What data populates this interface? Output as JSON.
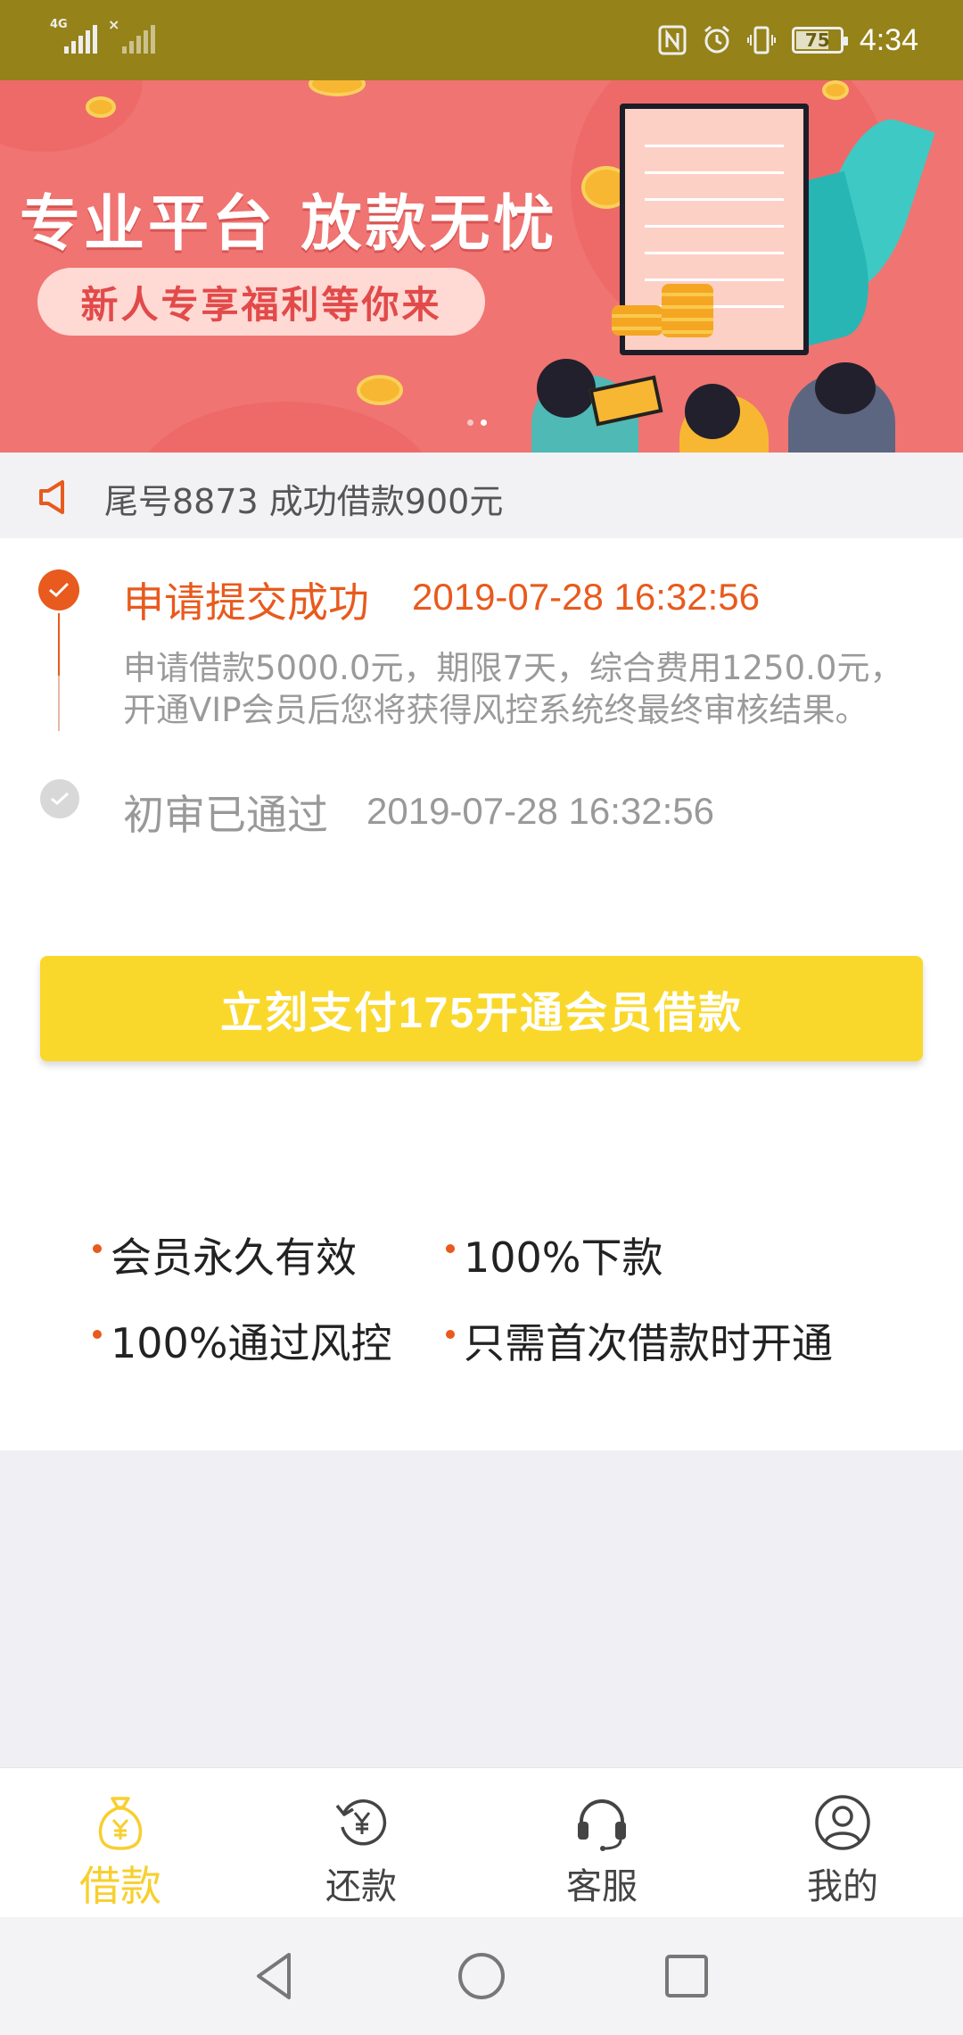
{
  "status_bar": {
    "network": "4G",
    "battery": "75",
    "battery_level": 0.75,
    "time": "4:34"
  },
  "banner": {
    "headline": "专业平台  放款无忧",
    "tagline": "新人专享福利等你来",
    "slide_count": 2,
    "active_slide": 1
  },
  "notice": {
    "icon": "speaker-icon",
    "text": "尾号8873 成功借款900元"
  },
  "steps": [
    {
      "title": "申请提交成功",
      "time": "2019-07-28 16:32:56",
      "description": "申请借款5000.0元，期限7天，综合费用1250.0元，开通VIP会员后您将获得风控系统终最终审核结果。",
      "status": "active"
    },
    {
      "title": "初审已通过",
      "time": "2019-07-28 16:32:56",
      "status": "done"
    }
  ],
  "pay_button": {
    "label": "立刻支付175开通会员借款"
  },
  "features": [
    "会员永久有效",
    "100%下款",
    "100%通过风控",
    "只需首次借款时开通"
  ],
  "tabs": [
    {
      "label": "借款",
      "icon": "money-bag-icon",
      "active": true
    },
    {
      "label": "还款",
      "icon": "repay-icon",
      "active": false
    },
    {
      "label": "客服",
      "icon": "headset-icon",
      "active": false
    },
    {
      "label": "我的",
      "icon": "profile-icon",
      "active": false
    }
  ],
  "colors": {
    "status_bar": "#958218",
    "banner": "#f07472",
    "accent_orange": "#e85a1d",
    "button_yellow": "#f9d82b",
    "tab_active": "#f7cf2e"
  }
}
